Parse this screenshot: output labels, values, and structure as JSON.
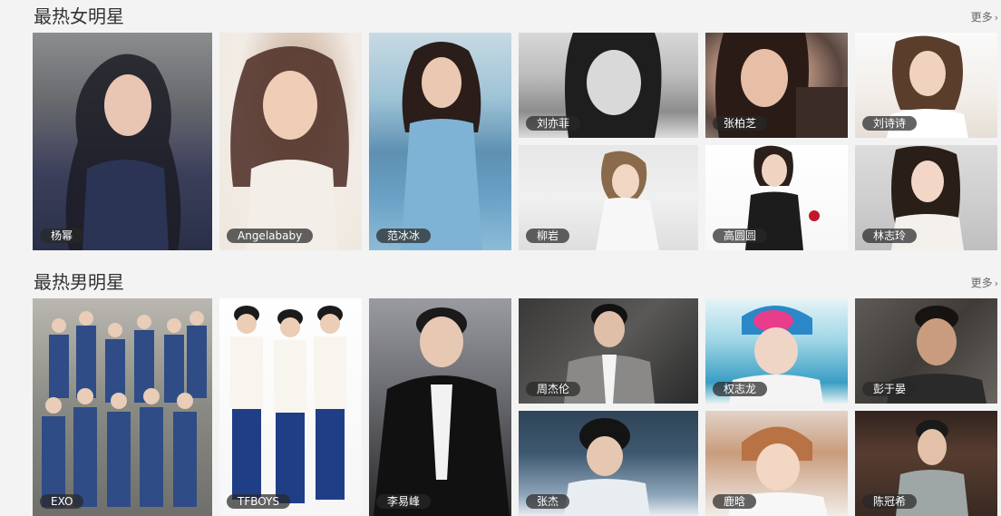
{
  "sections": [
    {
      "title": "最热女明星",
      "more": "更多",
      "cards": [
        {
          "name": "杨幂"
        },
        {
          "name": "Angelababy"
        },
        {
          "name": "范冰冰"
        },
        {
          "name": "刘亦菲"
        },
        {
          "name": "张柏芝"
        },
        {
          "name": "刘诗诗"
        },
        {
          "name": "柳岩"
        },
        {
          "name": "高圆圆"
        },
        {
          "name": "林志玲"
        }
      ]
    },
    {
      "title": "最热男明星",
      "more": "更多",
      "cards": [
        {
          "name": "EXO"
        },
        {
          "name": "TFBOYS"
        },
        {
          "name": "李易峰"
        },
        {
          "name": "周杰伦"
        },
        {
          "name": "权志龙"
        },
        {
          "name": "彭于晏"
        },
        {
          "name": "张杰"
        },
        {
          "name": "鹿晗"
        },
        {
          "name": "陈冠希"
        }
      ]
    }
  ],
  "icons": {
    "more": "chevron-right-icon"
  }
}
